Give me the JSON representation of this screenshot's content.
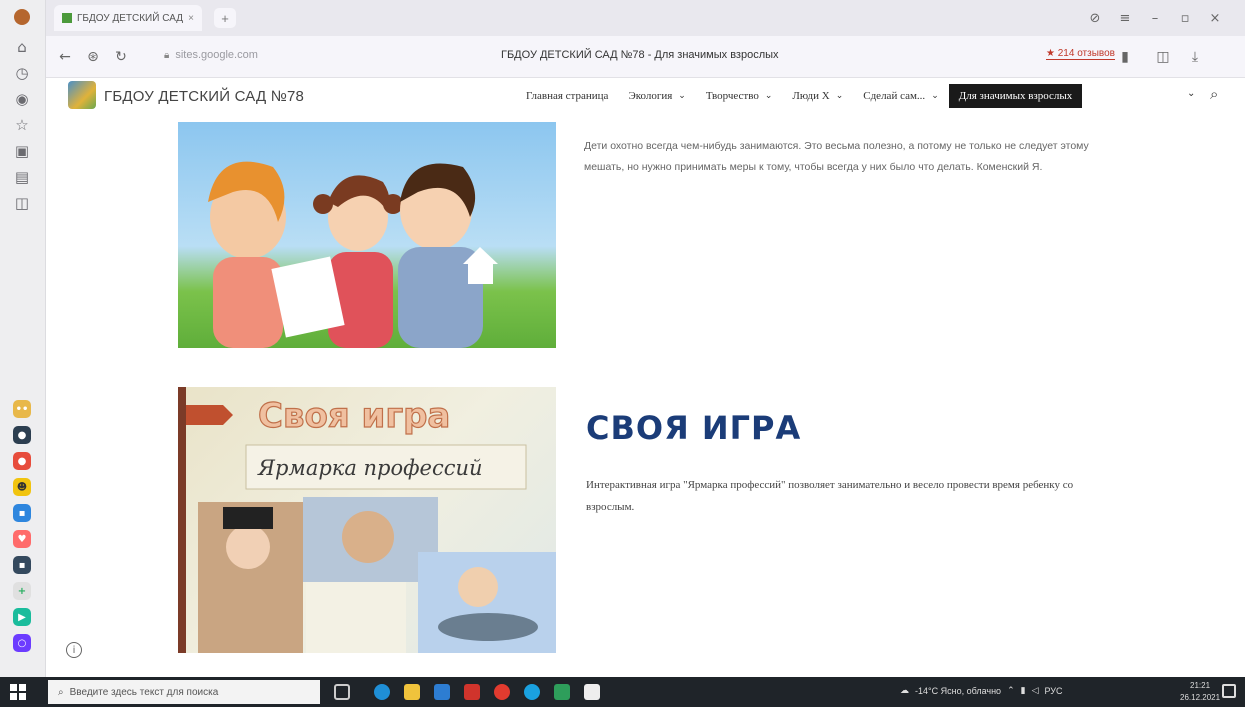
{
  "browser": {
    "tab_title": "ГБДОУ ДЕТСКИЙ САД",
    "tab_close": "×",
    "new_tab": "+",
    "url": "sites.google.com",
    "page_title": "ГБДОУ ДЕТСКИЙ САД №78 - Для значимых взрослых",
    "reviews_badge": "★ 214 отзывов"
  },
  "site": {
    "name": "ГБДОУ ДЕТСКИЙ САД №78",
    "nav": [
      {
        "label": "Главная страница",
        "has_menu": false
      },
      {
        "label": "Экология",
        "has_menu": true
      },
      {
        "label": "Творчество",
        "has_menu": true
      },
      {
        "label": "Люди Х",
        "has_menu": true
      },
      {
        "label": "Сделай сам...",
        "has_menu": true
      },
      {
        "label": "Для значимых взрослых",
        "has_menu": false,
        "active": true
      }
    ],
    "chevron": "⌄"
  },
  "main": {
    "quote": "Дети охотно всегда чем-нибудь занимаются. Это весьма полезно, а потому не только не следует этому мешать, но нужно принимать меры к тому, чтобы всегда у них было что делать. Коменский Я.",
    "game": {
      "image_title": "Своя игра",
      "image_subtitle": "Ярмарка профессий",
      "title": "СВОЯ ИГРА",
      "description": "Интерактивная игра \"Ярмарка профессий\" позволяет занимательно и весело провести время ребенку со взрослым."
    },
    "info": "i"
  },
  "taskbar": {
    "search_placeholder": "Введите здесь текст для поиска",
    "weather": "-14°C Ясно, облачно",
    "lang": "РУС",
    "time": "21:21",
    "date": "26.12.2021"
  },
  "colors": {
    "accent_title": "#1b3c78",
    "active_nav_bg": "#1a1a1a"
  }
}
